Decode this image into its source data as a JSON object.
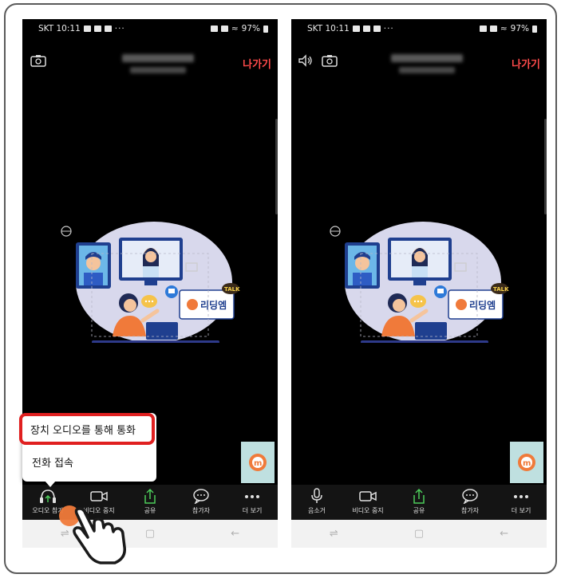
{
  "left_phone": {
    "status": {
      "carrier_time": "SKT 10:11",
      "more": "···",
      "battery": "97%"
    },
    "leave_label": "나가기",
    "brand_text": "리딩엠",
    "talk_badge": "TALK",
    "popup": {
      "item1": "장치 오디오를 통해 통화",
      "item2": "전화 접속"
    },
    "toolbar": [
      {
        "label": "오디오 참가"
      },
      {
        "label": "비디오 중지"
      },
      {
        "label": "공유"
      },
      {
        "label": "참가자"
      },
      {
        "label": "더 보기"
      }
    ]
  },
  "right_phone": {
    "status": {
      "carrier_time": "SKT 10:11",
      "more": "···",
      "battery": "97%"
    },
    "leave_label": "나가기",
    "brand_text": "리딩엠",
    "talk_badge": "TALK",
    "toolbar": [
      {
        "label": "음소거"
      },
      {
        "label": "비디오 중지"
      },
      {
        "label": "공유"
      },
      {
        "label": "참가자"
      },
      {
        "label": "더 보기"
      }
    ]
  },
  "colors": {
    "accent_red": "#e02020",
    "leave_red": "#ff4a4a",
    "share_green": "#4ccb5a",
    "tap_orange": "#f07a3a"
  }
}
